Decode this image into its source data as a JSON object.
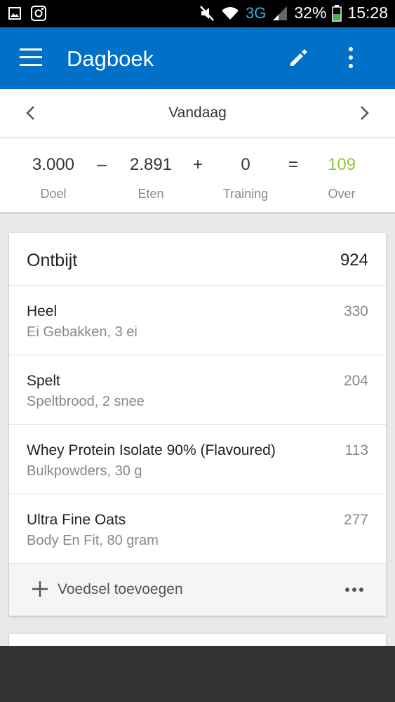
{
  "status_bar": {
    "battery": "32%",
    "network": "3G",
    "time": "15:28"
  },
  "app_bar": {
    "title": "Dagboek",
    "menu_icon": "hamburger-menu-icon",
    "edit_icon": "pencil-icon",
    "more_icon": "more-vertical-icon",
    "color": "#0070c9"
  },
  "date_nav": {
    "label": "Vandaag"
  },
  "summary": {
    "goal": {
      "value": "3.000",
      "label": "Doel"
    },
    "minus": "–",
    "food": {
      "value": "2.891",
      "label": "Eten"
    },
    "plus": "+",
    "exercise": {
      "value": "0",
      "label": "Training"
    },
    "equals": "=",
    "remaining": {
      "value": "109",
      "label": "Over",
      "color": "#8dc63f"
    }
  },
  "meal": {
    "name": "Ontbijt",
    "total": "924",
    "entries": [
      {
        "name": "Heel",
        "desc": "Ei Gebakken, 3 ei",
        "cal": "330"
      },
      {
        "name": "Spelt",
        "desc": "Speltbrood, 2 snee",
        "cal": "204"
      },
      {
        "name": "Whey Protein Isolate 90% (Flavoured)",
        "desc": "Bulkpowders, 30 g",
        "cal": "113"
      },
      {
        "name": "Ultra Fine Oats",
        "desc": "Body En Fit, 80 gram",
        "cal": "277"
      }
    ],
    "add_label": "Voedsel toevoegen"
  }
}
